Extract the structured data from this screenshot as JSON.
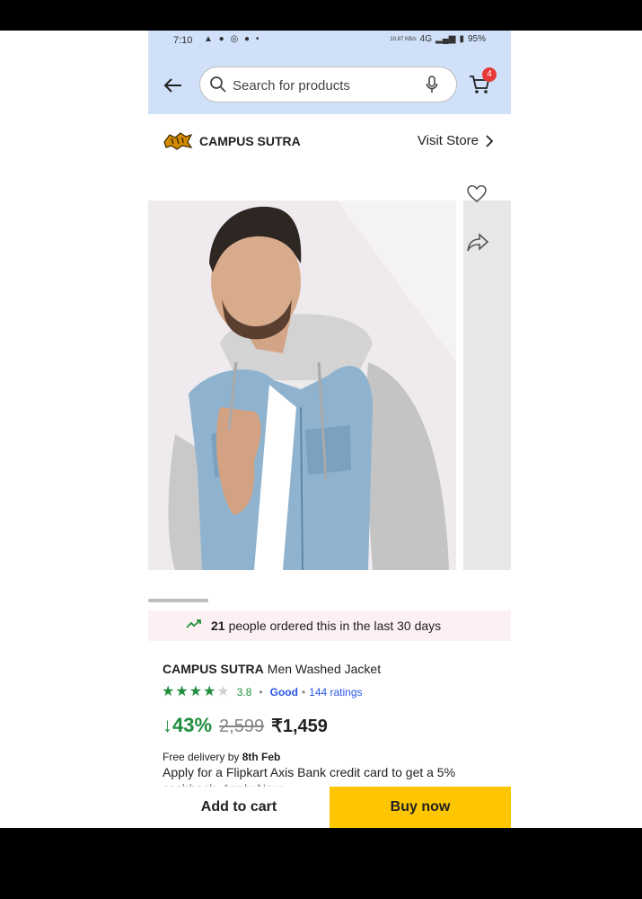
{
  "status": {
    "time": "7:10",
    "network_speed": "10.87 KB/s",
    "network": "4G",
    "battery": "95%"
  },
  "header": {
    "search_placeholder": "Search for products",
    "cart_count": "4"
  },
  "store": {
    "name": "CAMPUS SUTRA",
    "visit_label": "Visit Store"
  },
  "social_proof": {
    "count": "21",
    "text": "people ordered this in the last 30 days"
  },
  "product": {
    "brand": "CAMPUS SUTRA",
    "name": "Men Washed Jacket",
    "rating": "3.8",
    "rating_word": "Good",
    "ratings_count": "144 ratings",
    "stars_filled": 4,
    "discount": "↓43%",
    "mrp": "2,599",
    "price": "₹1,459"
  },
  "delivery": {
    "prefix": "Free delivery by",
    "date": "8th Feb"
  },
  "offer": {
    "text": "Apply for a Flipkart Axis Bank credit card to get a 5%",
    "more": "cashback. Apply Now"
  },
  "actions": {
    "add_to_cart": "Add to cart",
    "buy_now": "Buy now"
  },
  "colors": {
    "header_bg": "#cfe0f8",
    "buy_now": "#fdc601",
    "discount_green": "#1e8e3e",
    "link_blue": "#2a55e5",
    "cart_badge": "#e53935"
  }
}
